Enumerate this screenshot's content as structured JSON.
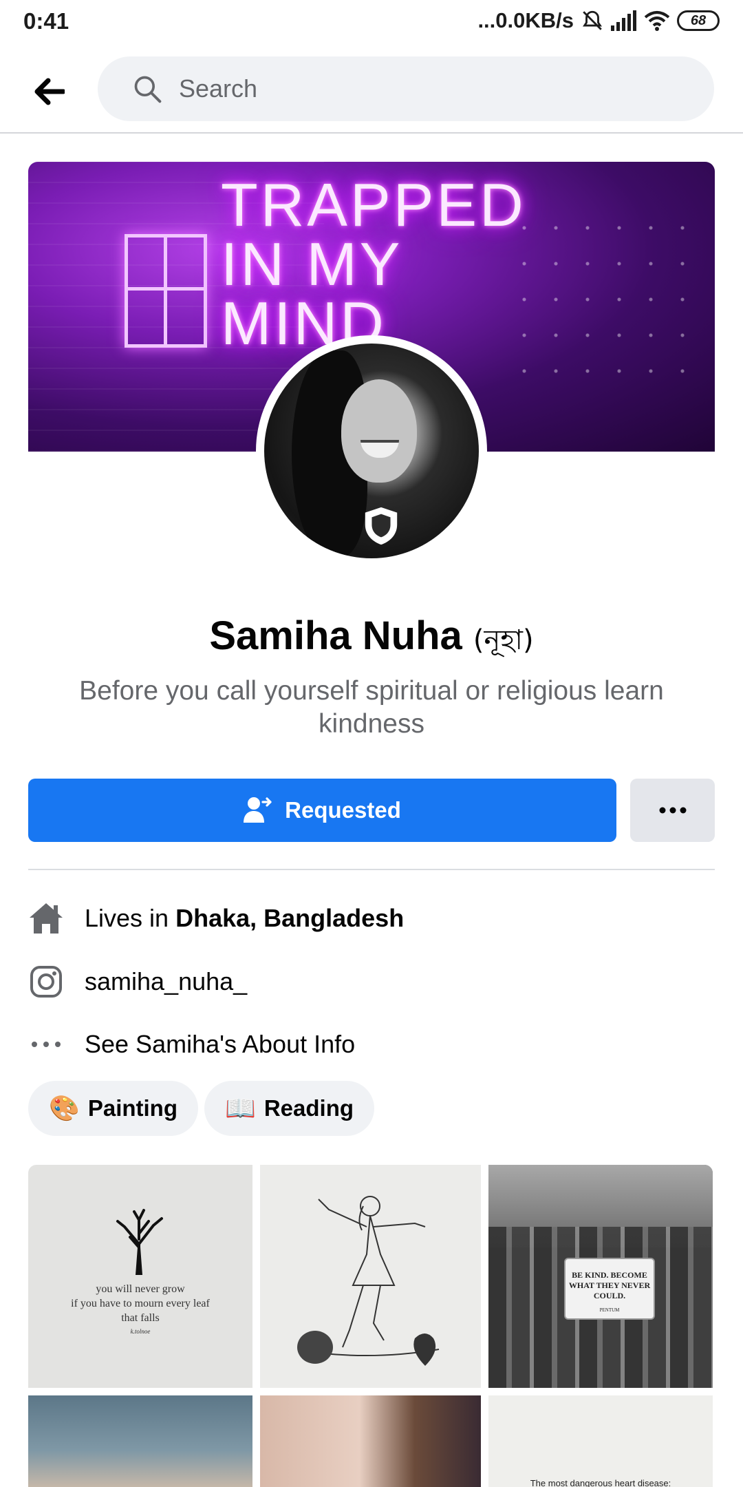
{
  "status_bar": {
    "time": "0:41",
    "network_speed": "...0.0KB/s",
    "battery": "68"
  },
  "search": {
    "placeholder": "Search"
  },
  "cover": {
    "neon_text": "TRAPPED\nIN MY\nMIND"
  },
  "profile": {
    "name": "Samiha Nuha",
    "alt_name": "(নূহা)",
    "bio": "Before you call yourself spiritual or religious learn kindness"
  },
  "actions": {
    "requested_label": "Requested"
  },
  "details": {
    "lives_in_prefix": "Lives in ",
    "lives_in_place": "Dhaka, Bangladesh",
    "instagram": "samiha_nuha_",
    "about": "See Samiha's About Info"
  },
  "hobbies": [
    {
      "emoji": "🎨",
      "label": "Painting"
    },
    {
      "emoji": "📖",
      "label": "Reading"
    }
  ],
  "photos": {
    "quote_line1": "you will never grow",
    "quote_line2": "if you have to mourn every leaf",
    "quote_line3": "that falls",
    "quote_author": "k.tolnoe",
    "sign_text": "BE KIND. BECOME WHAT THEY NEVER COULD.",
    "sign_sub": "PENTUM",
    "p6_text": "The most dangerous heart disease:"
  },
  "colors": {
    "accent": "#1877f2",
    "secondary_button": "#e4e6eb",
    "muted_text": "#65676b"
  }
}
